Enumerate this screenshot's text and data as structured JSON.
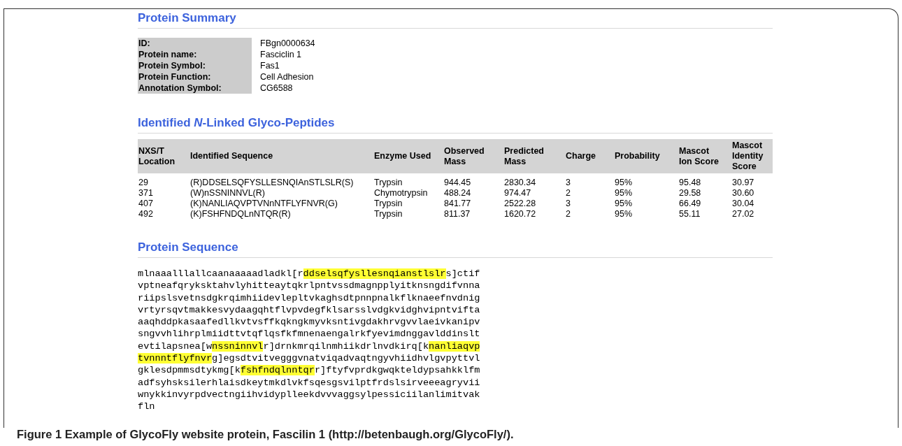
{
  "summary": {
    "title": "Protein Summary",
    "fields": [
      {
        "label": "ID:",
        "value": "FBgn0000634"
      },
      {
        "label": "Protein name:",
        "value": "Fasciclin 1"
      },
      {
        "label": "Protein Symbol:",
        "value": "Fas1"
      },
      {
        "label": "Protein Function:",
        "value": "Cell Adhesion"
      },
      {
        "label": "Annotation Symbol:",
        "value": "CG6588"
      }
    ]
  },
  "peptides": {
    "title": "Identified *N*-Linked Glyco-Peptides",
    "columns": [
      "NXS/T Location",
      "Identified Sequence",
      "Enzyme Used",
      "Observed Mass",
      "Predicted Mass",
      "Charge",
      "Probability",
      "Mascot Ion Score",
      "Mascot Identity Score"
    ],
    "rows": [
      [
        "29",
        "(R)DDSELSQFYSLLESNQIAnSTLSLR(S)",
        "Trypsin",
        "944.45",
        "2830.34",
        "3",
        "95%",
        "95.48",
        "30.97"
      ],
      [
        "371",
        "(W)nSSNINNVL(R)",
        "Chymotrypsin",
        "488.24",
        "974.47",
        "2",
        "95%",
        "29.58",
        "30.60"
      ],
      [
        "407",
        "(K)NANLIAQVPTVNnNTFLYFNVR(G)",
        "Trypsin",
        "841.77",
        "2522.28",
        "3",
        "95%",
        "66.49",
        "30.04"
      ],
      [
        "492",
        "(K)FSHFNDQLnNTQR(R)",
        "Trypsin",
        "811.37",
        "1620.72",
        "2",
        "95%",
        "55.11",
        "27.02"
      ]
    ]
  },
  "sequence": {
    "title": "Protein Sequence",
    "lines": [
      [
        {
          "text": "mlnaaalllallcaanaaaaadladkl[r",
          "highlighted": false
        },
        {
          "text": "ddselsqfysllesnqianstlslr",
          "highlighted": true
        },
        {
          "text": "s]ctif",
          "highlighted": false
        }
      ],
      [
        {
          "text": "vptneafqryksktahvlyhitteaytqkrlpntvssdmagnpplyitknsngdifvnna",
          "highlighted": false
        }
      ],
      [
        {
          "text": "riipslsvetnsdgkrqimhiidevlepltvkaghsdtpnnpnalkflknaeefnvdnig",
          "highlighted": false
        }
      ],
      [
        {
          "text": "vrtyrsqvtmakkesvydaagqhtflvpvdegfklsarsslvdgkvidghvipntvifta",
          "highlighted": false
        }
      ],
      [
        {
          "text": "aaqhddpkasaafedllkvtvsffkqkngkmyvksntivgdakhrvgvvlaeivkanipv",
          "highlighted": false
        }
      ],
      [
        {
          "text": "sngvvhlihrplmiidttvtqflqsfkfmnenaengalrkfyevimdnggavlddinslt",
          "highlighted": false
        }
      ],
      [
        {
          "text": "evtilapsnea[w",
          "highlighted": false
        },
        {
          "text": "nssninnvl",
          "highlighted": true
        },
        {
          "text": "r]drnkmrqilnmhiikdrlnvdkirq[k",
          "highlighted": false
        },
        {
          "text": "nanliaqvp",
          "highlighted": true
        }
      ],
      [
        {
          "text": "tvnnntflyfnvr",
          "highlighted": true
        },
        {
          "text": "g]egsdtvitvegggvnatviqadvaqtngyvhiidhvlgvpyttvl",
          "highlighted": false
        }
      ],
      [
        {
          "text": "gklesdpmmsdtykmg[k",
          "highlighted": false
        },
        {
          "text": "fshfndqlnntqr",
          "highlighted": true
        },
        {
          "text": "r]ftyfvprdkgwqkteldypsahkklfm",
          "highlighted": false
        }
      ],
      [
        {
          "text": "adfsyhsksilerhlaisdkeytmkdlvkfsqesgsvilptfrdslsirveeeagryvii",
          "highlighted": false
        }
      ],
      [
        {
          "text": "wnykkinvyrpdvectngiihvidyplleekdvvvaggsylpessiciilanlimitvak",
          "highlighted": false
        }
      ],
      [
        {
          "text": "fln",
          "highlighted": false
        }
      ]
    ]
  },
  "caption": "**Figure 1** Example of GlycoFly website protein, Fascilin 1 (http://betenbaugh.org/GlycoFly/)."
}
